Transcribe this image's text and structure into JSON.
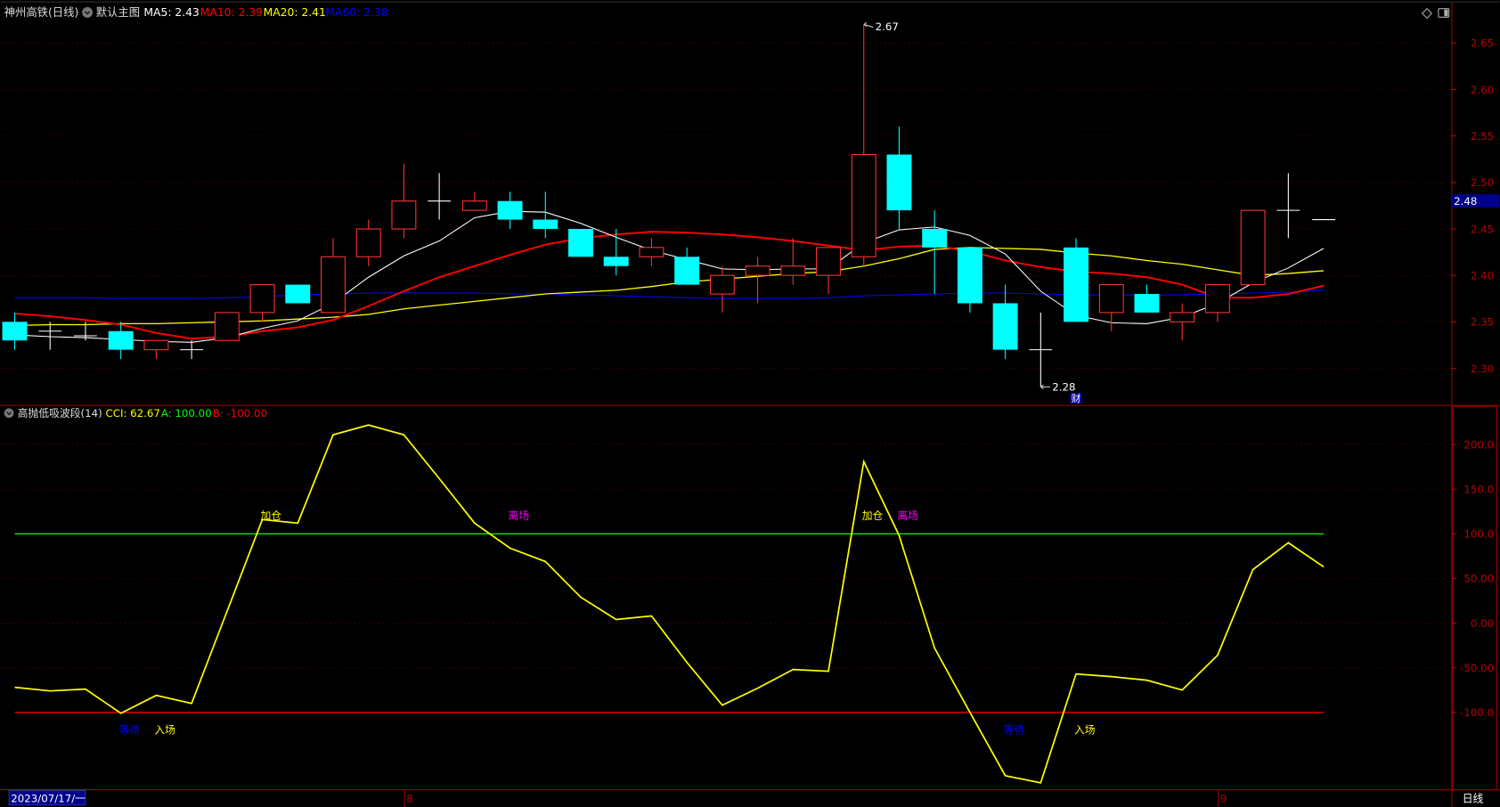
{
  "header": {
    "title": "神州高铁(日线)",
    "template": "默认主图",
    "ma5": "MA5: 2.43",
    "ma10": "MA10: 2.39",
    "ma20": "MA20: 2.41",
    "ma60": "MA60: 2.38"
  },
  "indicator_header": {
    "name": "高抛低吸波段(14)",
    "cci": "CCI: 62.67",
    "a": "A: 100.00",
    "b": "B: -100.00"
  },
  "price_axis": {
    "ticks": [
      "2.65",
      "2.60",
      "2.55",
      "2.50",
      "2.45",
      "2.40",
      "2.35",
      "2.30"
    ],
    "tick_values": [
      2.65,
      2.6,
      2.55,
      2.5,
      2.45,
      2.4,
      2.35,
      2.3
    ],
    "current_price": "2.48",
    "current_value": 2.48
  },
  "cci_axis": {
    "ticks": [
      "200.0",
      "150.0",
      "100.0",
      "50.00",
      "0.00",
      "-50.00",
      "-100.0"
    ],
    "tick_values": [
      200,
      150,
      100,
      50,
      0,
      -50,
      -100
    ]
  },
  "annotations": {
    "high": "2.67",
    "low": "2.28",
    "fin_marker": "财"
  },
  "signals": [
    {
      "label": "加仓",
      "index": 7.3,
      "level": 100,
      "color": "#ffff00"
    },
    {
      "label": "离场",
      "index": 14.3,
      "level": 100,
      "color": "#ff00ff"
    },
    {
      "label": "加仓",
      "index": 24.3,
      "level": 100,
      "color": "#ffff00"
    },
    {
      "label": "离场",
      "index": 25.3,
      "level": 100,
      "color": "#ff00ff"
    },
    {
      "label": "等待",
      "index": 3.3,
      "level": -100,
      "color": "#0000ff"
    },
    {
      "label": "入场",
      "index": 4.3,
      "level": -100,
      "color": "#ffff00"
    },
    {
      "label": "等待",
      "index": 28.3,
      "level": -100,
      "color": "#0000ff"
    },
    {
      "label": "入场",
      "index": 30.3,
      "level": -100,
      "color": "#ffff00"
    }
  ],
  "date_bar": {
    "start_date": "2023/07/17/一",
    "month_labels": [
      {
        "label": "8",
        "index": 11.1
      },
      {
        "label": "9",
        "index": 34.1
      }
    ],
    "period": "日线"
  },
  "colors": {
    "up": "#ff3232",
    "down": "#00ffff",
    "ma5": "#ffffff",
    "ma10": "#ff0000",
    "ma20": "#ffff00",
    "ma60": "#0000ff",
    "cci": "#ffff00",
    "a": "#00ff00",
    "b": "#ff0000",
    "axis": "#c00000"
  },
  "chart_data": [
    {
      "type": "candlestick",
      "title": "神州高铁(日线)",
      "ylim": [
        2.26,
        2.69
      ],
      "ohlc": [
        [
          2.35,
          2.36,
          2.32,
          2.33
        ],
        [
          2.34,
          2.35,
          2.32,
          2.34
        ],
        [
          2.335,
          2.35,
          2.33,
          2.335
        ],
        [
          2.34,
          2.35,
          2.31,
          2.32
        ],
        [
          2.32,
          2.33,
          2.31,
          2.33
        ],
        [
          2.32,
          2.33,
          2.31,
          2.32
        ],
        [
          2.33,
          2.36,
          2.33,
          2.36
        ],
        [
          2.36,
          2.39,
          2.35,
          2.39
        ],
        [
          2.39,
          2.39,
          2.37,
          2.37
        ],
        [
          2.36,
          2.44,
          2.36,
          2.42
        ],
        [
          2.42,
          2.46,
          2.41,
          2.45
        ],
        [
          2.45,
          2.52,
          2.44,
          2.48
        ],
        [
          2.48,
          2.51,
          2.46,
          2.48
        ],
        [
          2.47,
          2.49,
          2.47,
          2.48
        ],
        [
          2.48,
          2.49,
          2.45,
          2.46
        ],
        [
          2.46,
          2.49,
          2.44,
          2.45
        ],
        [
          2.45,
          2.45,
          2.42,
          2.42
        ],
        [
          2.42,
          2.45,
          2.4,
          2.41
        ],
        [
          2.42,
          2.44,
          2.41,
          2.43
        ],
        [
          2.42,
          2.43,
          2.39,
          2.39
        ],
        [
          2.38,
          2.41,
          2.36,
          2.4
        ],
        [
          2.4,
          2.42,
          2.37,
          2.41
        ],
        [
          2.4,
          2.44,
          2.39,
          2.41
        ],
        [
          2.4,
          2.43,
          2.38,
          2.43
        ],
        [
          2.42,
          2.67,
          2.41,
          2.53
        ],
        [
          2.53,
          2.56,
          2.45,
          2.47
        ],
        [
          2.45,
          2.47,
          2.38,
          2.43
        ],
        [
          2.43,
          2.43,
          2.36,
          2.37
        ],
        [
          2.37,
          2.39,
          2.31,
          2.32
        ],
        [
          2.32,
          2.36,
          2.28,
          2.32
        ],
        [
          2.43,
          2.44,
          2.35,
          2.35
        ],
        [
          2.36,
          2.39,
          2.34,
          2.39
        ],
        [
          2.38,
          2.39,
          2.36,
          2.36
        ],
        [
          2.35,
          2.37,
          2.33,
          2.36
        ],
        [
          2.36,
          2.39,
          2.35,
          2.39
        ],
        [
          2.39,
          2.47,
          2.39,
          2.47
        ],
        [
          2.47,
          2.51,
          2.44,
          2.47
        ],
        [
          2.46,
          2.46,
          2.46,
          2.46
        ]
      ],
      "series": [
        {
          "name": "MA5",
          "values": [
            2.336,
            2.334,
            2.333,
            2.331,
            2.329,
            2.328,
            2.333,
            2.343,
            2.351,
            2.37,
            2.398,
            2.421,
            2.437,
            2.462,
            2.469,
            2.468,
            2.456,
            2.441,
            2.427,
            2.417,
            2.407,
            2.406,
            2.407,
            2.407,
            2.435,
            2.449,
            2.452,
            2.443,
            2.423,
            2.383,
            2.357,
            2.349,
            2.348,
            2.355,
            2.37,
            2.392,
            2.408,
            2.429
          ]
        },
        {
          "name": "MA10",
          "values": [
            2.359,
            2.356,
            2.352,
            2.347,
            2.338,
            2.332,
            2.334,
            2.34,
            2.344,
            2.352,
            2.367,
            2.383,
            2.398,
            2.41,
            2.422,
            2.433,
            2.44,
            2.444,
            2.447,
            2.446,
            2.444,
            2.441,
            2.437,
            2.432,
            2.427,
            2.431,
            2.432,
            2.426,
            2.416,
            2.409,
            2.404,
            2.402,
            2.398,
            2.39,
            2.376,
            2.376,
            2.38,
            2.389
          ]
        },
        {
          "name": "MA20",
          "values": [
            2.346,
            2.347,
            2.347,
            2.348,
            2.348,
            2.349,
            2.35,
            2.351,
            2.353,
            2.355,
            2.358,
            2.364,
            2.368,
            2.372,
            2.376,
            2.38,
            2.382,
            2.384,
            2.388,
            2.393,
            2.396,
            2.399,
            2.402,
            2.404,
            2.41,
            2.418,
            2.428,
            2.43,
            2.429,
            2.428,
            2.424,
            2.421,
            2.416,
            2.412,
            2.406,
            2.4,
            2.402,
            2.405
          ]
        },
        {
          "name": "MA60",
          "values": [
            2.376,
            2.376,
            2.376,
            2.375,
            2.375,
            2.375,
            2.376,
            2.377,
            2.379,
            2.38,
            2.381,
            2.381,
            2.381,
            2.381,
            2.38,
            2.38,
            2.379,
            2.378,
            2.377,
            2.376,
            2.375,
            2.375,
            2.375,
            2.376,
            2.378,
            2.379,
            2.38,
            2.381,
            2.381,
            2.38,
            2.379,
            2.379,
            2.379,
            2.379,
            2.38,
            2.381,
            2.382,
            2.384
          ]
        }
      ]
    },
    {
      "type": "line",
      "title": "高抛低吸波段(14)",
      "ylim": [
        -190,
        245
      ],
      "series": [
        {
          "name": "CCI",
          "values": [
            -72,
            -76,
            -74,
            -101,
            -81,
            -90,
            13,
            116,
            112,
            211,
            222,
            211,
            162,
            112,
            84,
            69,
            29,
            4,
            8,
            -44,
            -92,
            -73,
            -52,
            -54,
            181,
            98,
            -28,
            -100,
            -171,
            -179,
            -57,
            -60,
            -64,
            -75,
            -36,
            60,
            90,
            63
          ]
        },
        {
          "name": "A",
          "values": [
            100
          ]
        },
        {
          "name": "B",
          "values": [
            -100
          ]
        }
      ]
    }
  ]
}
